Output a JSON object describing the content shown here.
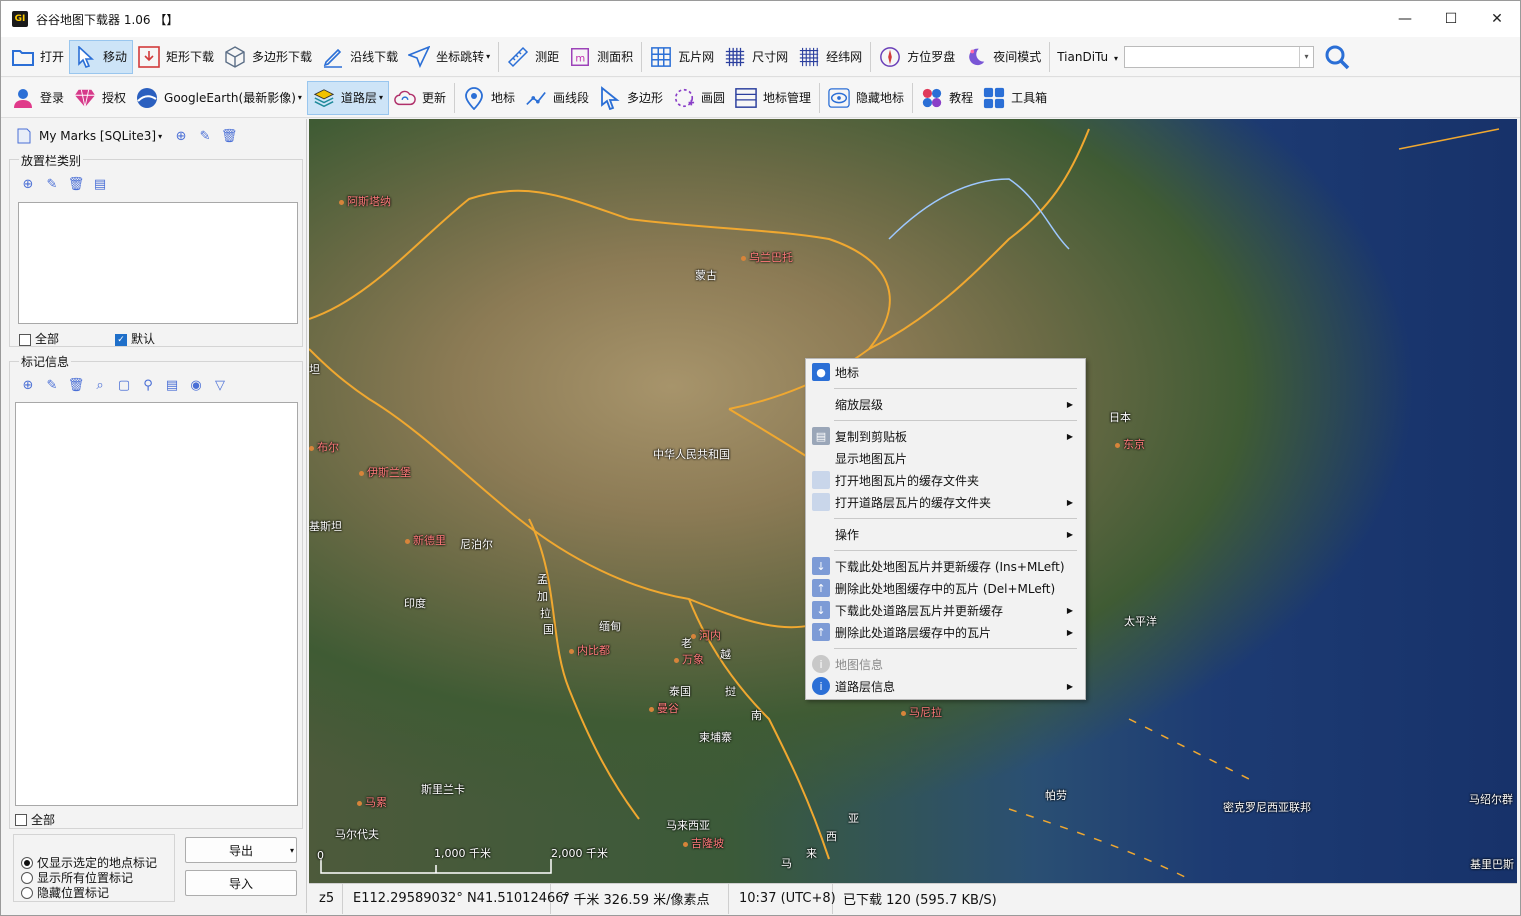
{
  "window": {
    "title": "谷谷地图下载器 1.06 【】",
    "app_icon_text": "GI",
    "controls": {
      "minimize": "—",
      "maximize": "☐",
      "close": "✕"
    }
  },
  "toolbar1": {
    "items": [
      {
        "label": "打开",
        "icon": "folder-icon"
      },
      {
        "label": "移动",
        "icon": "cursor-icon",
        "active": true
      },
      {
        "label": "矩形下载",
        "icon": "download-box-icon"
      },
      {
        "label": "多边形下载",
        "icon": "cube-icon"
      },
      {
        "label": "沿线下载",
        "icon": "pencil-icon"
      },
      {
        "label": "坐标跳转",
        "icon": "send-icon",
        "caret": "▾"
      },
      {
        "label": "测距",
        "icon": "ruler-icon"
      },
      {
        "label": "测面积",
        "icon": "area-icon"
      },
      {
        "label": "瓦片网",
        "icon": "grid-icon"
      },
      {
        "label": "尺寸网",
        "icon": "hash-icon"
      },
      {
        "label": "经纬网",
        "icon": "latlon-grid-icon"
      },
      {
        "label": "方位罗盘",
        "icon": "compass-icon"
      },
      {
        "label": "夜间模式",
        "icon": "moon-icon"
      }
    ],
    "provider": "TianDiTu",
    "provider_caret": "▾",
    "search_value": "",
    "combo_arrow": "▾"
  },
  "toolbar2": {
    "items": [
      {
        "label": "登录",
        "icon": "user-icon"
      },
      {
        "label": "授权",
        "icon": "diamond-icon"
      },
      {
        "label": "GoogleEarth(最新影像)",
        "icon": "google-earth-icon",
        "caret": "▾"
      },
      {
        "label": "道路层",
        "icon": "layers-icon",
        "caret": "▾",
        "active": true
      },
      {
        "label": "更新",
        "icon": "cloud-refresh-icon"
      },
      {
        "label": "地标",
        "icon": "pin-icon"
      },
      {
        "label": "画线段",
        "icon": "polyline-icon"
      },
      {
        "label": "多边形",
        "icon": "polygon-icon"
      },
      {
        "label": "画圆",
        "icon": "circle-icon"
      },
      {
        "label": "地标管理",
        "icon": "list-icon"
      },
      {
        "label": "隐藏地标",
        "icon": "eye-icon"
      },
      {
        "label": "教程",
        "icon": "tutorial-icon"
      },
      {
        "label": "工具箱",
        "icon": "toolbox-icon"
      }
    ]
  },
  "left_panel": {
    "db_label": "My Marks [SQLite3]",
    "db_caret": "▾",
    "category_group": "放置栏类别",
    "all_label": "全部",
    "default_label": "默认",
    "marker_group": "标记信息",
    "all_label_2": "全部",
    "export_label": "导出",
    "import_label": "导入",
    "radio_options": [
      {
        "label": "仅显示选定的地点标记",
        "checked": true
      },
      {
        "label": "显示所有位置标记",
        "checked": false
      },
      {
        "label": "隐藏位置标记",
        "checked": false
      }
    ]
  },
  "map": {
    "labels": [
      {
        "text": "阿斯塔纳",
        "red": true
      },
      {
        "text": "乌兰巴托",
        "red": true
      },
      {
        "text": "蒙古",
        "red": false
      },
      {
        "text": "中华人民共和国",
        "red": false
      },
      {
        "text": "日本",
        "red": false
      },
      {
        "text": "东京",
        "red": true
      },
      {
        "text": "伊斯兰堡",
        "red": true
      },
      {
        "text": "新德里",
        "red": true
      },
      {
        "text": "尼泊尔",
        "red": false
      },
      {
        "text": "印度",
        "red": false
      },
      {
        "text": "孟",
        "red": false
      },
      {
        "text": "加",
        "red": false
      },
      {
        "text": "拉",
        "red": false
      },
      {
        "text": "国",
        "red": false
      },
      {
        "text": "缅甸",
        "red": false
      },
      {
        "text": "内比都",
        "red": true
      },
      {
        "text": "老",
        "red": false
      },
      {
        "text": "河内",
        "red": true
      },
      {
        "text": "万象",
        "red": true
      },
      {
        "text": "越",
        "red": false
      },
      {
        "text": "泰国",
        "red": false
      },
      {
        "text": "挝",
        "red": false
      },
      {
        "text": "曼谷",
        "red": true
      },
      {
        "text": "南",
        "red": false
      },
      {
        "text": "柬埔寨",
        "red": false
      },
      {
        "text": "马尼拉",
        "red": true
      },
      {
        "text": "太平洋",
        "red": false
      },
      {
        "text": "斯里兰卡",
        "red": false
      },
      {
        "text": "马累",
        "red": true
      },
      {
        "text": "马尔代夫",
        "red": false
      },
      {
        "text": "马来西亚",
        "red": false
      },
      {
        "text": "吉隆坡",
        "red": true
      },
      {
        "text": "西",
        "red": false
      },
      {
        "text": "亚",
        "red": false
      },
      {
        "text": "马",
        "red": false
      },
      {
        "text": "来",
        "red": false
      },
      {
        "text": "帕劳",
        "red": false
      },
      {
        "text": "密克罗尼西亚联邦",
        "red": false
      },
      {
        "text": "马绍尔群",
        "red": false
      },
      {
        "text": "基里巴斯",
        "red": false
      },
      {
        "text": "坦",
        "red": false
      },
      {
        "text": "布尔",
        "red": false
      },
      {
        "text": "基斯坦",
        "red": false
      }
    ],
    "scale": {
      "zero": "0",
      "mid": "1,000 千米",
      "end": "2,000 千米"
    }
  },
  "context_menu": {
    "items": [
      {
        "label": "地标",
        "icon": "pin-icon",
        "submenu": false,
        "disabled": false
      },
      {
        "label": "缩放层级",
        "icon": "",
        "submenu": true,
        "disabled": false
      },
      {
        "label": "复制到剪贴板",
        "icon": "clipboard-icon",
        "submenu": true,
        "disabled": false
      },
      {
        "label": "显示地图瓦片",
        "icon": "",
        "submenu": false,
        "disabled": false
      },
      {
        "label": "打开地图瓦片的缓存文件夹",
        "icon": "folder-icon",
        "submenu": false,
        "disabled": false
      },
      {
        "label": "打开道路层瓦片的缓存文件夹",
        "icon": "folder-icon",
        "submenu": true,
        "disabled": false
      },
      {
        "label": "操作",
        "icon": "",
        "submenu": true,
        "disabled": false
      },
      {
        "label": "下载此处地图瓦片并更新缓存 (Ins+MLeft)",
        "icon": "download-arrow-icon",
        "submenu": false,
        "disabled": false
      },
      {
        "label": "删除此处地图缓存中的瓦片 (Del+MLeft)",
        "icon": "upload-arrow-icon",
        "submenu": false,
        "disabled": false
      },
      {
        "label": "下载此处道路层瓦片并更新缓存",
        "icon": "download-arrow-icon",
        "submenu": true,
        "disabled": false
      },
      {
        "label": "删除此处道路层缓存中的瓦片",
        "icon": "upload-arrow-icon",
        "submenu": true,
        "disabled": false
      },
      {
        "label": "地图信息",
        "icon": "info-icon",
        "submenu": false,
        "disabled": true
      },
      {
        "label": "道路层信息",
        "icon": "info-icon",
        "submenu": true,
        "disabled": false
      }
    ],
    "submenu_arrow": "▶"
  },
  "statusbar": {
    "zoom": "z5",
    "coords": "E112.29589032° N41.51012466°",
    "resolution": "7 千米 326.59 米/像素点",
    "time": "10:37 (UTC+8)",
    "downloaded": "已下载 120 (595.7 KB/S)"
  },
  "colors": {
    "accent": "#1f6fc9",
    "active_bg": "#cde4f7",
    "border_orange": "#f0a830",
    "city_red": "#ff7a7a"
  }
}
